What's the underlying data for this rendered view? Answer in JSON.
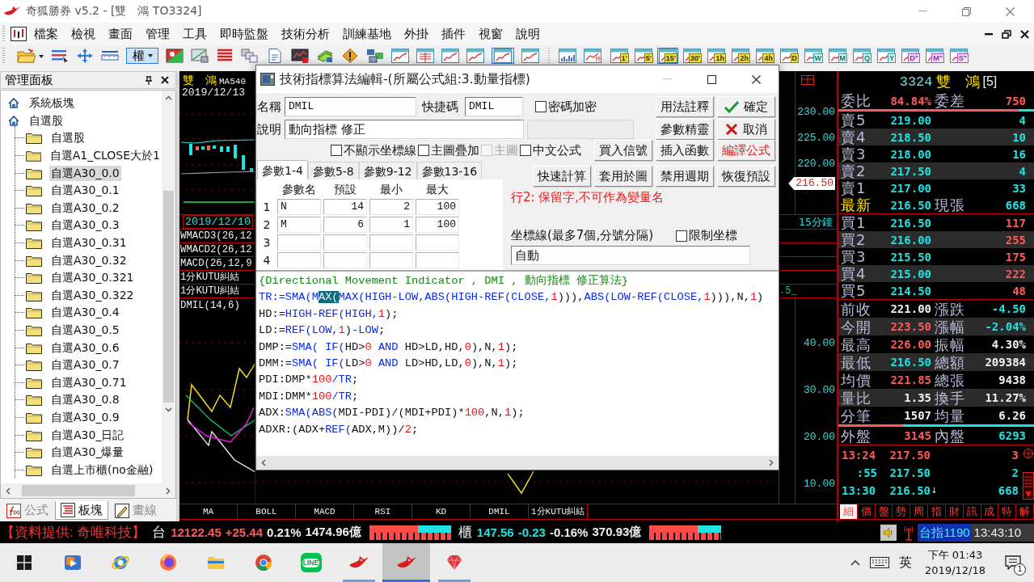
{
  "window": {
    "title": "奇狐勝券 v5.2 - [雙　鴻 TO3324]"
  },
  "menu": [
    "檔案",
    "檢視",
    "畫面",
    "管理",
    "工具",
    "即時監盤",
    "技術分析",
    "訓練基地",
    "外掛",
    "插件",
    "視窗",
    "說明"
  ],
  "toolbar": {
    "rights_button": {
      "label": "權",
      "selected": true
    },
    "layout_button": {
      "selected": true
    },
    "periods": [
      {
        "label": "1'",
        "kind": "intraday",
        "selected": false
      },
      {
        "label": "5'",
        "kind": "intraday",
        "selected": false
      },
      {
        "label": "15'",
        "kind": "intraday",
        "selected": true
      },
      {
        "label": "30'",
        "kind": "intraday",
        "selected": false
      },
      {
        "label": "1h",
        "kind": "intraday",
        "selected": false
      },
      {
        "label": "2h",
        "kind": "intraday",
        "selected": false
      },
      {
        "label": "4h",
        "kind": "intraday",
        "selected": false
      },
      {
        "label": "D",
        "kind": "intraday",
        "selected": false
      },
      {
        "label": "W",
        "kind": "calendar",
        "selected": false
      },
      {
        "label": "M",
        "kind": "calendar",
        "selected": false
      },
      {
        "label": "Q",
        "kind": "calendar",
        "selected": false
      },
      {
        "label": "Y",
        "kind": "calendar",
        "selected": false
      },
      {
        "label": "D\"",
        "kind": "multi",
        "selected": false
      },
      {
        "label": "M\"",
        "kind": "multi",
        "selected": false
      },
      {
        "label": "S\"",
        "kind": "multi",
        "selected": false
      }
    ]
  },
  "panel": {
    "title": "管理面板",
    "tree": [
      {
        "label": "系統板塊",
        "selected": false
      },
      {
        "label": "自選股",
        "selected": false,
        "children": [
          {
            "label": "自選股",
            "selected": false
          },
          {
            "label": "自選A1_CLOSE大於1",
            "selected": false
          },
          {
            "label": "自選A30_0.0",
            "selected": true
          },
          {
            "label": "自選A30_0.1",
            "selected": false
          },
          {
            "label": "自選A30_0.2",
            "selected": false
          },
          {
            "label": "自選A30_0.3",
            "selected": false
          },
          {
            "label": "自選A30_0.31",
            "selected": false
          },
          {
            "label": "自選A30_0.32",
            "selected": false
          },
          {
            "label": "自選A30_0.321",
            "selected": false
          },
          {
            "label": "自選A30_0.322",
            "selected": false
          },
          {
            "label": "自選A30_0.4",
            "selected": false
          },
          {
            "label": "自選A30_0.5",
            "selected": false
          },
          {
            "label": "自選A30_0.6",
            "selected": false
          },
          {
            "label": "自選A30_0.7",
            "selected": false
          },
          {
            "label": "自選A30_0.71",
            "selected": false
          },
          {
            "label": "自選A30_0.8",
            "selected": false
          },
          {
            "label": "自選A30_0.9",
            "selected": false
          },
          {
            "label": "自選A30_日記",
            "selected": false
          },
          {
            "label": "自選A30_爆量",
            "selected": false
          },
          {
            "label": "自選上市櫃(no金融)",
            "selected": false
          }
        ]
      }
    ],
    "tabs": [
      {
        "label": "公式",
        "selected": false
      },
      {
        "label": "板塊",
        "selected": true
      },
      {
        "label": "畫線",
        "selected": false
      }
    ]
  },
  "chart": {
    "stock": "雙　鴻",
    "overlay": "MA540",
    "date": "2019/12/13",
    "cursor_date": "2019/12/10",
    "pane_labels": [
      "WMACD3(26,12",
      "WMACD2(26,12",
      "MACD(26,12,9",
      "1分KUTU糾結",
      "1分KUTU糾結"
    ],
    "indicator_label": "DMIL(14,6)",
    "price_ticks": [
      "230.00",
      "225.00",
      "220.00"
    ],
    "last_price": "216.50",
    "period": "15分鐘",
    "fragment": ".5_",
    "indicator_ticks": [
      "40.00",
      "30.00",
      "20.00",
      "10.00"
    ],
    "tabs": [
      {
        "label": "MA",
        "selected": false
      },
      {
        "label": "BOLL",
        "selected": false
      },
      {
        "label": "MACD",
        "selected": false
      },
      {
        "label": "RSI",
        "selected": false
      },
      {
        "label": "KD",
        "selected": false
      },
      {
        "label": "DMIL",
        "selected": false
      },
      {
        "label": "1分KUTU糾結",
        "selected": false
      }
    ]
  },
  "dialog": {
    "title": "技術指標算法編輯-(所屬公式組:3.動量指標)",
    "name": {
      "label": "名稱",
      "value": "DMIL"
    },
    "shortcut": {
      "label": "快捷碼",
      "value": "DMIL"
    },
    "password": {
      "label": "密碼加密",
      "checked": false
    },
    "description": {
      "label": "說明",
      "value": "動向指標 修正"
    },
    "extra_field": {
      "disabled": true
    },
    "options": [
      {
        "label": "不顯示坐標線",
        "checked": false,
        "disabled": false
      },
      {
        "label": "主圖疊加",
        "checked": false,
        "disabled": false
      },
      {
        "label": "主圖",
        "checked": false,
        "disabled": true
      },
      {
        "label": "中文公式",
        "checked": false,
        "disabled": false
      }
    ],
    "button_rows": [
      [
        {
          "label": "用法註釋",
          "kind": "plain"
        },
        {
          "label": "確定",
          "kind": "ok"
        }
      ],
      [
        {
          "label": "參數精靈",
          "kind": "plain"
        },
        {
          "label": "取消",
          "kind": "cancel"
        }
      ],
      [
        {
          "label": "買入信號",
          "kind": "plain"
        },
        {
          "label": "插入函數",
          "kind": "plain"
        },
        {
          "label": "編譯公式",
          "kind": "alert"
        }
      ],
      [
        {
          "label": "快速計算",
          "kind": "plain"
        },
        {
          "label": "套用於圖",
          "kind": "plain"
        },
        {
          "label": "禁用週期",
          "kind": "plain"
        },
        {
          "label": "恢復預設",
          "kind": "plain"
        }
      ]
    ],
    "param_tabs": [
      {
        "label": "參數1-4",
        "selected": true
      },
      {
        "label": "參數5-8",
        "selected": false
      },
      {
        "label": "參數9-12",
        "selected": false
      },
      {
        "label": "參數13-16",
        "selected": false
      }
    ],
    "param_columns": [
      "參數名",
      "預設",
      "最小",
      "最大"
    ],
    "params": [
      {
        "number": "1",
        "name": "N",
        "default": "14",
        "min": "2",
        "max": "100"
      },
      {
        "number": "2",
        "name": "M",
        "default": "6",
        "min": "1",
        "max": "100"
      },
      {
        "number": "3"
      },
      {
        "number": "4"
      }
    ],
    "error": "行2: 保留字,不可作為變量名",
    "axis": {
      "label": "坐標線(最多7個,分號分隔)",
      "limit": {
        "label": "限制坐標",
        "checked": false
      },
      "value": "自動"
    },
    "code": [
      [
        {
          "kind": "comment",
          "text": "{Directional Movement Indicator , DMI , 動向指標 修正算法}"
        }
      ],
      [
        {
          "kind": "keyword",
          "text": "TR:=SMA(M"
        },
        {
          "kind": "selected",
          "text": "AX("
        },
        {
          "kind": "keyword",
          "text": "MAX(HIGH-LOW,ABS(HIGH-REF(CLOSE,"
        },
        {
          "kind": "number",
          "text": "1"
        },
        {
          "kind": "plain",
          "text": "))),"
        },
        {
          "kind": "keyword",
          "text": "ABS(LOW-REF(CLOSE,"
        },
        {
          "kind": "number",
          "text": "1"
        },
        {
          "kind": "plain",
          "text": "))),N,"
        },
        {
          "kind": "number",
          "text": "1"
        },
        {
          "kind": "plain",
          "text": ")"
        }
      ],
      [
        {
          "kind": "plain",
          "text": "HD:="
        },
        {
          "kind": "keyword",
          "text": "HIGH-REF(HIGH,"
        },
        {
          "kind": "number",
          "text": "1"
        },
        {
          "kind": "plain",
          "text": ");"
        }
      ],
      [
        {
          "kind": "plain",
          "text": "LD:="
        },
        {
          "kind": "keyword",
          "text": "REF(LOW,"
        },
        {
          "kind": "number",
          "text": "1"
        },
        {
          "kind": "plain",
          "text": ")"
        },
        {
          "kind": "keyword",
          "text": "-LOW"
        },
        {
          "kind": "plain",
          "text": ";"
        }
      ],
      [
        {
          "kind": "plain",
          "text": "DMP:="
        },
        {
          "kind": "keyword",
          "text": "SMA( IF("
        },
        {
          "kind": "plain",
          "text": "HD>"
        },
        {
          "kind": "number",
          "text": "0"
        },
        {
          "kind": "keyword",
          "text": " AND "
        },
        {
          "kind": "plain",
          "text": "HD>LD,HD,"
        },
        {
          "kind": "number",
          "text": "0"
        },
        {
          "kind": "plain",
          "text": "),N,"
        },
        {
          "kind": "number",
          "text": "1"
        },
        {
          "kind": "plain",
          "text": ");"
        }
      ],
      [
        {
          "kind": "plain",
          "text": "DMM:="
        },
        {
          "kind": "keyword",
          "text": "SMA( IF("
        },
        {
          "kind": "plain",
          "text": "LD>"
        },
        {
          "kind": "number",
          "text": "0"
        },
        {
          "kind": "keyword",
          "text": " AND "
        },
        {
          "kind": "plain",
          "text": "LD>HD,LD,"
        },
        {
          "kind": "number",
          "text": "0"
        },
        {
          "kind": "plain",
          "text": "),N,"
        },
        {
          "kind": "number",
          "text": "1"
        },
        {
          "kind": "plain",
          "text": ");"
        }
      ],
      [
        {
          "kind": "plain",
          "text": "PDI:DMP*"
        },
        {
          "kind": "number",
          "text": "100"
        },
        {
          "kind": "keyword",
          "text": "/TR"
        },
        {
          "kind": "plain",
          "text": ";"
        }
      ],
      [
        {
          "kind": "plain",
          "text": "MDI:DMM*"
        },
        {
          "kind": "number",
          "text": "100"
        },
        {
          "kind": "keyword",
          "text": "/TR"
        },
        {
          "kind": "plain",
          "text": ";"
        }
      ],
      [
        {
          "kind": "plain",
          "text": "ADX:"
        },
        {
          "kind": "keyword",
          "text": "SMA(ABS("
        },
        {
          "kind": "plain",
          "text": "MDI-PDI)/(MDI+PDI)*"
        },
        {
          "kind": "number",
          "text": "100"
        },
        {
          "kind": "plain",
          "text": ",N,"
        },
        {
          "kind": "number",
          "text": "1"
        },
        {
          "kind": "plain",
          "text": ");"
        }
      ],
      [
        {
          "kind": "plain",
          "text": "ADXR:(ADX+"
        },
        {
          "kind": "keyword",
          "text": "REF("
        },
        {
          "kind": "plain",
          "text": "ADX,M))/"
        },
        {
          "kind": "number",
          "text": "2"
        },
        {
          "kind": "plain",
          "text": ";"
        }
      ]
    ]
  },
  "quote": {
    "code": "3324",
    "name": "雙　鴻",
    "depth": "[5]",
    "ratio": {
      "label": "委比",
      "value": "84.84%",
      "label2": "委差",
      "value2": "750",
      "level": 0.92
    },
    "asks": [
      {
        "label": "賣5",
        "price": "219.00",
        "volume": "4"
      },
      {
        "label": "賣4",
        "price": "218.50",
        "volume": "10"
      },
      {
        "label": "賣3",
        "price": "218.00",
        "volume": "16"
      },
      {
        "label": "賣2",
        "price": "217.50",
        "volume": "4"
      },
      {
        "label": "賣1",
        "price": "217.00",
        "volume": "33"
      }
    ],
    "last": {
      "label": "最新",
      "value": "216.50",
      "label2": "現張",
      "value2": "668"
    },
    "bids": [
      {
        "label": "買1",
        "price": "216.50",
        "volume": "117"
      },
      {
        "label": "買2",
        "price": "216.00",
        "volume": "255"
      },
      {
        "label": "買3",
        "price": "215.50",
        "volume": "175"
      },
      {
        "label": "買4",
        "price": "215.00",
        "volume": "222"
      },
      {
        "label": "買5",
        "price": "214.50",
        "volume": "48"
      }
    ],
    "stats": [
      {
        "label": "前收",
        "value": "221.00",
        "color": "#f2f2f2"
      },
      {
        "label": "漲跌",
        "value": "-4.50",
        "color": "#1fe3e3"
      },
      {
        "label": "今開",
        "value": "223.50",
        "color": "#ff5a5a"
      },
      {
        "label": "漲幅",
        "value": "-2.04%",
        "color": "#1fe3e3"
      },
      {
        "label": "最高",
        "value": "226.00",
        "color": "#ff5a5a"
      },
      {
        "label": "振幅",
        "value": "4.30%",
        "color": "#f2f2f2"
      },
      {
        "label": "最低",
        "value": "216.50",
        "color": "#1fe3e3"
      },
      {
        "label": "總額",
        "value": "209384",
        "color": "#f2f2f2"
      },
      {
        "label": "均價",
        "value": "221.85",
        "color": "#ff5a5a"
      },
      {
        "label": "總張",
        "value": "9438",
        "color": "#f2f2f2"
      },
      {
        "label": "量比",
        "value": "1.35",
        "color": "#f2f2f2"
      },
      {
        "label": "換手",
        "value": "11.27%",
        "color": "#f2f2f2"
      },
      {
        "label": "分筆",
        "value": "1507",
        "color": "#f2f2f2"
      },
      {
        "label": "均量",
        "value": "6.26",
        "color": "#f2f2f2"
      }
    ],
    "flow": {
      "label": "外盤",
      "value": "3145",
      "label2": "內盤",
      "value2": "6293",
      "level": 0.33
    },
    "ticks": [
      {
        "time": "13:24",
        "price": "217.50",
        "volume": "3",
        "color": "#ff5a5a"
      },
      {
        "time": ":55",
        "price": "217.50",
        "volume": "2",
        "color": "#1fe3e3"
      },
      {
        "time": "13:30",
        "price": "216.50",
        "arrow": "↓",
        "volume": "668",
        "color": "#1fe3e3"
      }
    ],
    "tabs": [
      {
        "label": "細",
        "selected": true
      },
      {
        "label": "價",
        "selected": false
      },
      {
        "label": "盤",
        "selected": false
      },
      {
        "label": "勢",
        "selected": false
      },
      {
        "label": "周",
        "selected": false
      },
      {
        "label": "指",
        "selected": false
      },
      {
        "label": "財",
        "selected": false
      },
      {
        "label": "訊",
        "selected": false
      },
      {
        "label": "成",
        "selected": false
      },
      {
        "label": "特",
        "selected": false
      },
      {
        "label": "解",
        "selected": false
      }
    ]
  },
  "ticker": {
    "source": "【資料提供: 奇唯科技】",
    "markets": [
      {
        "name": "台",
        "index": "12122.45",
        "change": "+25.44",
        "percent": "0.21%",
        "turnover": "1474.96億",
        "color": "#ff5a5a",
        "level": 0.6
      },
      {
        "name": "櫃",
        "index": "147.56",
        "change": "-0.23",
        "percent": "-0.16%",
        "turnover": "370.93億",
        "color": "#1fe3e3",
        "level": 0.67
      }
    ],
    "futures": "台指1190",
    "clock": "13:43:10"
  },
  "taskbar": {
    "apps": [
      {
        "running": false,
        "active": false
      },
      {
        "running": false,
        "active": false
      },
      {
        "running": false,
        "active": false
      },
      {
        "running": false,
        "active": false
      },
      {
        "running": false,
        "active": false
      },
      {
        "label": "LINE",
        "running": false,
        "active": false
      },
      {
        "running": true,
        "active": false
      },
      {
        "running": true,
        "active": true
      },
      {
        "running": true,
        "active": false
      }
    ],
    "ime": "英",
    "time": "下午 01:43",
    "date": "2019/12/18",
    "notifications": "1"
  }
}
